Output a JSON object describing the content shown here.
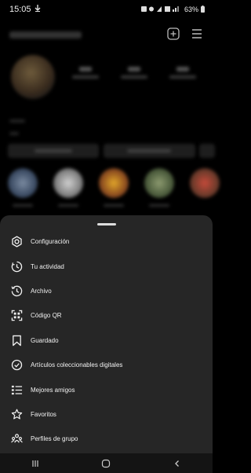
{
  "status": {
    "time": "15:05",
    "battery": "63%"
  },
  "sheet": {
    "items": [
      {
        "label": "Configuración",
        "icon": "gear-icon"
      },
      {
        "label": "Tu actividad",
        "icon": "activity-icon"
      },
      {
        "label": "Archivo",
        "icon": "archive-icon"
      },
      {
        "label": "Código QR",
        "icon": "qr-code-icon"
      },
      {
        "label": "Guardado",
        "icon": "bookmark-icon"
      },
      {
        "label": "Artículos coleccionables digitales",
        "icon": "verified-check-icon"
      },
      {
        "label": "Mejores amigos",
        "icon": "close-friends-list-icon"
      },
      {
        "label": "Favoritos",
        "icon": "star-icon"
      },
      {
        "label": "Perfiles de grupo",
        "icon": "group-profiles-icon"
      }
    ]
  },
  "colors": {
    "sheet_bg": "#262626",
    "page_bg": "#000000",
    "text": "#f2f2f2"
  }
}
